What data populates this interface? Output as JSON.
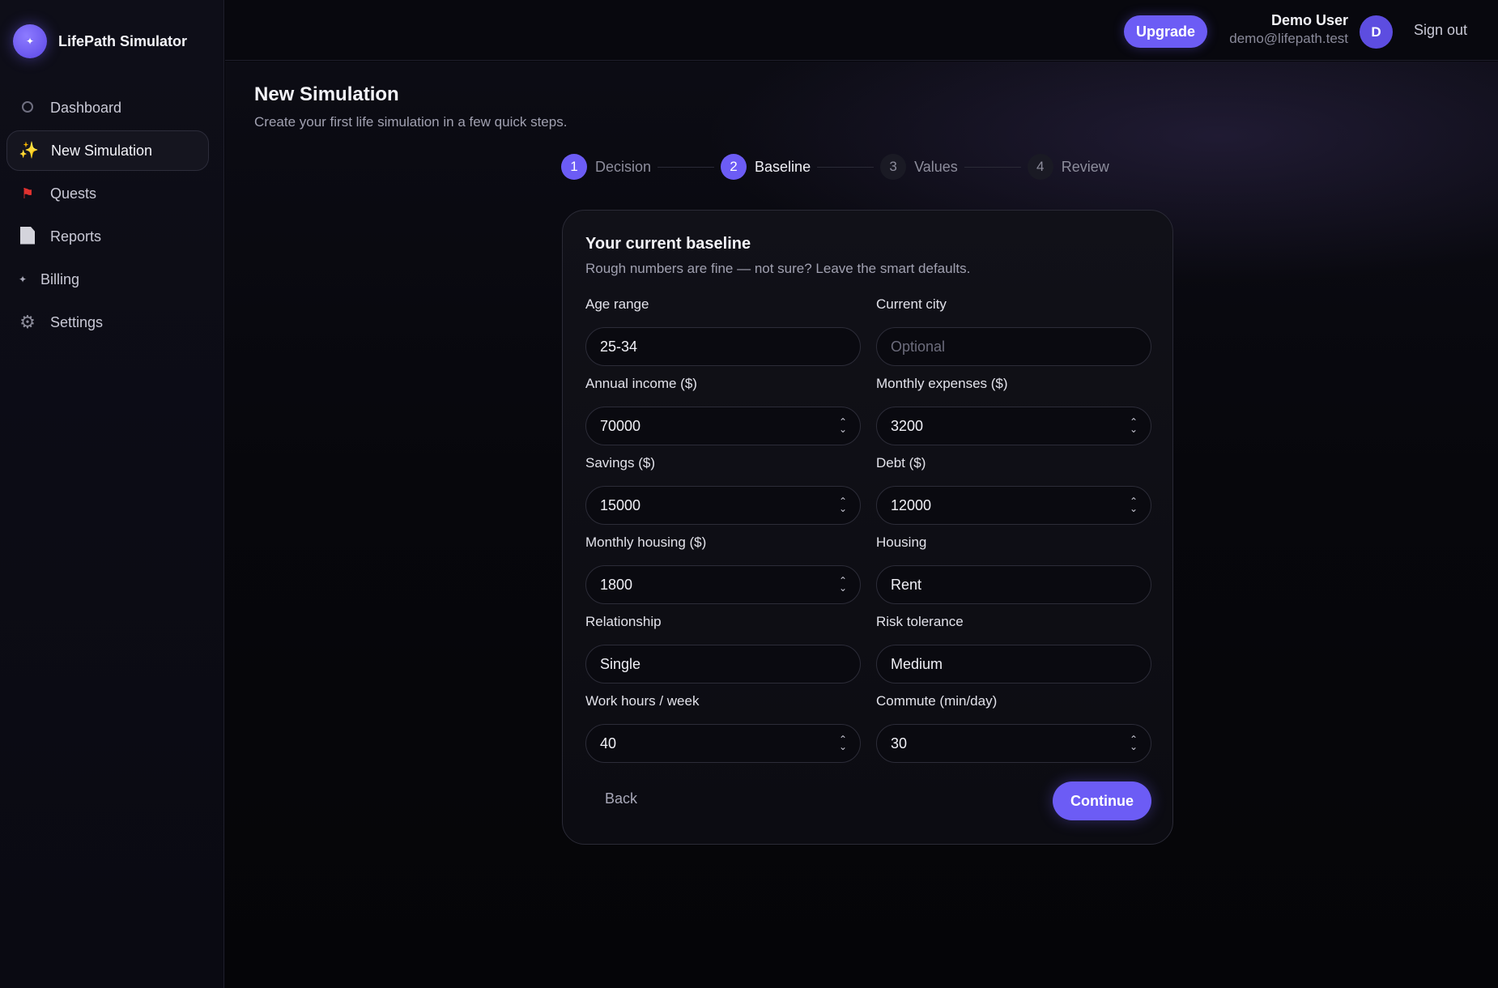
{
  "app": {
    "name": "LifePath Simulator",
    "logo_icon": "sparkle-icon"
  },
  "sidebar": {
    "items": [
      {
        "label": "Dashboard",
        "icon": "dashboard-icon",
        "active": false
      },
      {
        "label": "New Simulation",
        "icon": "sparkles-icon",
        "active": true
      },
      {
        "label": "Quests",
        "icon": "flag-icon",
        "active": false
      },
      {
        "label": "Reports",
        "icon": "document-icon",
        "active": false
      },
      {
        "label": "Billing",
        "icon": "billing-icon",
        "active": false
      },
      {
        "label": "Settings",
        "icon": "gear-icon",
        "active": false
      }
    ]
  },
  "header": {
    "upgrade_label": "Upgrade",
    "user_name": "Demo User",
    "user_email": "demo@lifepath.test",
    "avatar_initial": "D",
    "signout_label": "Sign out"
  },
  "page": {
    "title": "New Simulation",
    "subtitle": "Create your first life simulation in a few quick steps."
  },
  "stepper": {
    "current_step": 2,
    "steps": [
      {
        "num": "1",
        "label": "Decision",
        "state": "done"
      },
      {
        "num": "2",
        "label": "Baseline",
        "state": "current"
      },
      {
        "num": "3",
        "label": "Values",
        "state": "upcoming"
      },
      {
        "num": "4",
        "label": "Review",
        "state": "upcoming"
      }
    ]
  },
  "form": {
    "title": "Your current baseline",
    "subtitle": "Rough numbers are fine — not sure? Leave the smart defaults.",
    "fields": {
      "age_range": {
        "label": "Age range",
        "value": "25-34"
      },
      "current_city": {
        "label": "Current city",
        "value": "",
        "placeholder": "Optional"
      },
      "annual_income": {
        "label": "Annual income ($)",
        "value": "70000"
      },
      "monthly_expenses": {
        "label": "Monthly expenses ($)",
        "value": "3200"
      },
      "savings": {
        "label": "Savings ($)",
        "value": "15000"
      },
      "debt": {
        "label": "Debt ($)",
        "value": "12000"
      },
      "monthly_housing": {
        "label": "Monthly housing ($)",
        "value": "1800"
      },
      "housing": {
        "label": "Housing",
        "value": "Rent"
      },
      "relationship": {
        "label": "Relationship",
        "value": "Single"
      },
      "risk_tolerance": {
        "label": "Risk tolerance",
        "value": "Medium"
      },
      "work_hours": {
        "label": "Work hours / week",
        "value": "40"
      },
      "commute": {
        "label": "Commute (min/day)",
        "value": "30"
      }
    },
    "back_label": "Back",
    "continue_label": "Continue"
  },
  "colors": {
    "accent": "#6c5cf5",
    "background": "#06060b",
    "card_border": "#2a2a36"
  }
}
